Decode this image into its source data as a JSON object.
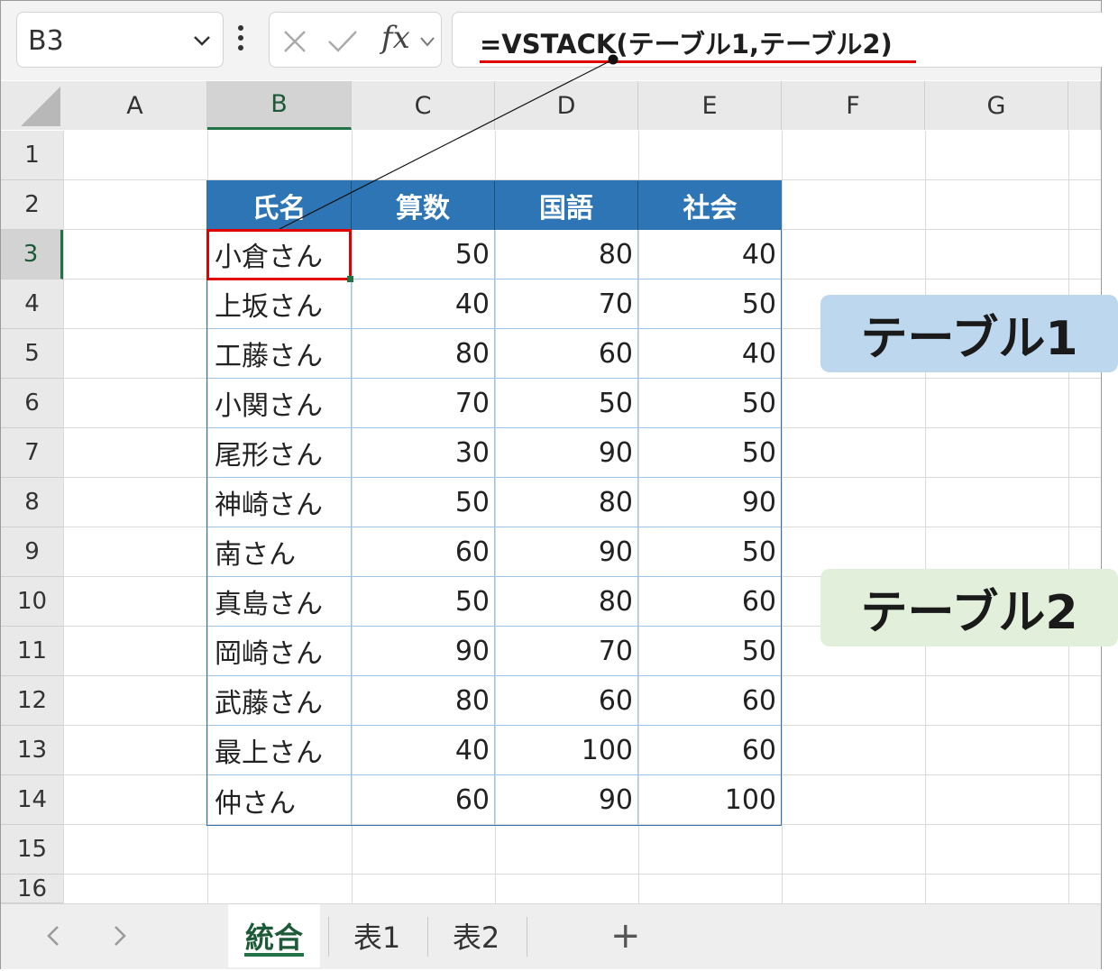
{
  "formula_bar": {
    "name_box": "B3",
    "formula": "=VSTACK(テーブル1,テーブル2)",
    "fx_label": "fx"
  },
  "columns": [
    "A",
    "B",
    "C",
    "D",
    "E",
    "F",
    "G"
  ],
  "selected_column": "B",
  "rows": [
    "1",
    "2",
    "3",
    "4",
    "5",
    "6",
    "7",
    "8",
    "9",
    "10",
    "11",
    "12",
    "13",
    "14",
    "15",
    "16"
  ],
  "selected_row": "3",
  "table": {
    "headers": [
      "氏名",
      "算数",
      "国語",
      "社会"
    ],
    "data": [
      [
        "小倉さん",
        "50",
        "80",
        "40"
      ],
      [
        "上坂さん",
        "40",
        "70",
        "50"
      ],
      [
        "工藤さん",
        "80",
        "60",
        "40"
      ],
      [
        "小関さん",
        "70",
        "50",
        "50"
      ],
      [
        "尾形さん",
        "30",
        "90",
        "50"
      ],
      [
        "神崎さん",
        "50",
        "80",
        "90"
      ],
      [
        "南さん",
        "60",
        "90",
        "50"
      ],
      [
        "真島さん",
        "50",
        "80",
        "60"
      ],
      [
        "岡崎さん",
        "90",
        "70",
        "50"
      ],
      [
        "武藤さん",
        "80",
        "60",
        "60"
      ],
      [
        "最上さん",
        "40",
        "100",
        "60"
      ],
      [
        "仲さん",
        "60",
        "90",
        "100"
      ]
    ]
  },
  "callouts": {
    "table1": "テーブル1",
    "table2": "テーブル2"
  },
  "sheet_tabs": {
    "tabs": [
      "統合",
      "表1",
      "表2"
    ],
    "active": "統合",
    "add_label": "+"
  },
  "colors": {
    "header_fill": "#2e75b6",
    "accent_green": "#217346",
    "highlight_red": "#e00000",
    "callout1": "#bdd7ee",
    "callout2": "#e2efda"
  }
}
